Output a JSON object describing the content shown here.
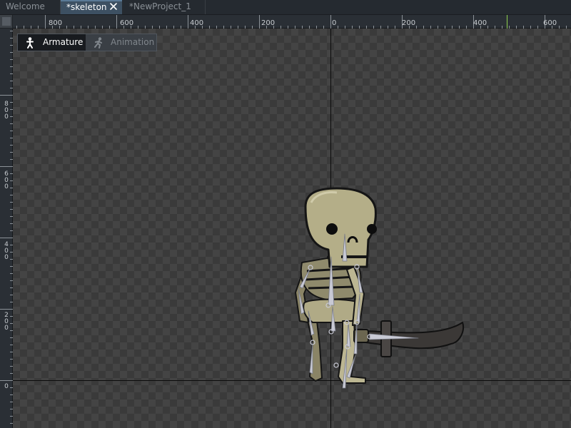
{
  "tabs": [
    {
      "label": "Welcome",
      "active": false
    },
    {
      "label": "*skeleton",
      "active": true
    },
    {
      "label": "*NewProject_1",
      "active": false
    }
  ],
  "ruler": {
    "horizontal": [
      "800",
      "600",
      "400",
      "200",
      "0",
      "200",
      "400",
      "600"
    ],
    "vertical": [
      "800",
      "600",
      "400",
      "200",
      "0"
    ]
  },
  "mode_toggle": {
    "armature_label": "Armature",
    "animation_label": "Animation",
    "selected": "Armature"
  },
  "icons": {
    "close": "close-icon",
    "armature": "armature-mode-icon",
    "animation": "animation-mode-icon"
  },
  "colors": {
    "active_tab": "#3d5062",
    "ruler_marker": "#8fd14f",
    "bone": "#c8c9d4"
  }
}
